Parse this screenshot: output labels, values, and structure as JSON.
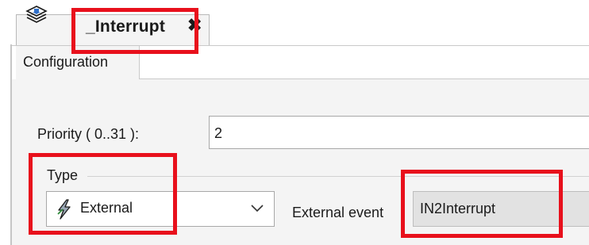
{
  "editor_tab": {
    "title": "_Interrupt",
    "close_glyph": "✖",
    "icon": "stacked-layers-icon"
  },
  "subtabs": [
    {
      "label": "Configuration",
      "active": true
    }
  ],
  "priority": {
    "label": "Priority ( 0..31  ):",
    "value": "2"
  },
  "type": {
    "group_label": "Type",
    "selected": "External",
    "icon": "lightning-bolt-icon"
  },
  "external_event": {
    "label": "External event",
    "value": "IN2Interrupt"
  },
  "colors": {
    "highlight": "#e8101c",
    "panel_background": "#f4f4f4",
    "readonly_field": "#e2e2e2"
  }
}
